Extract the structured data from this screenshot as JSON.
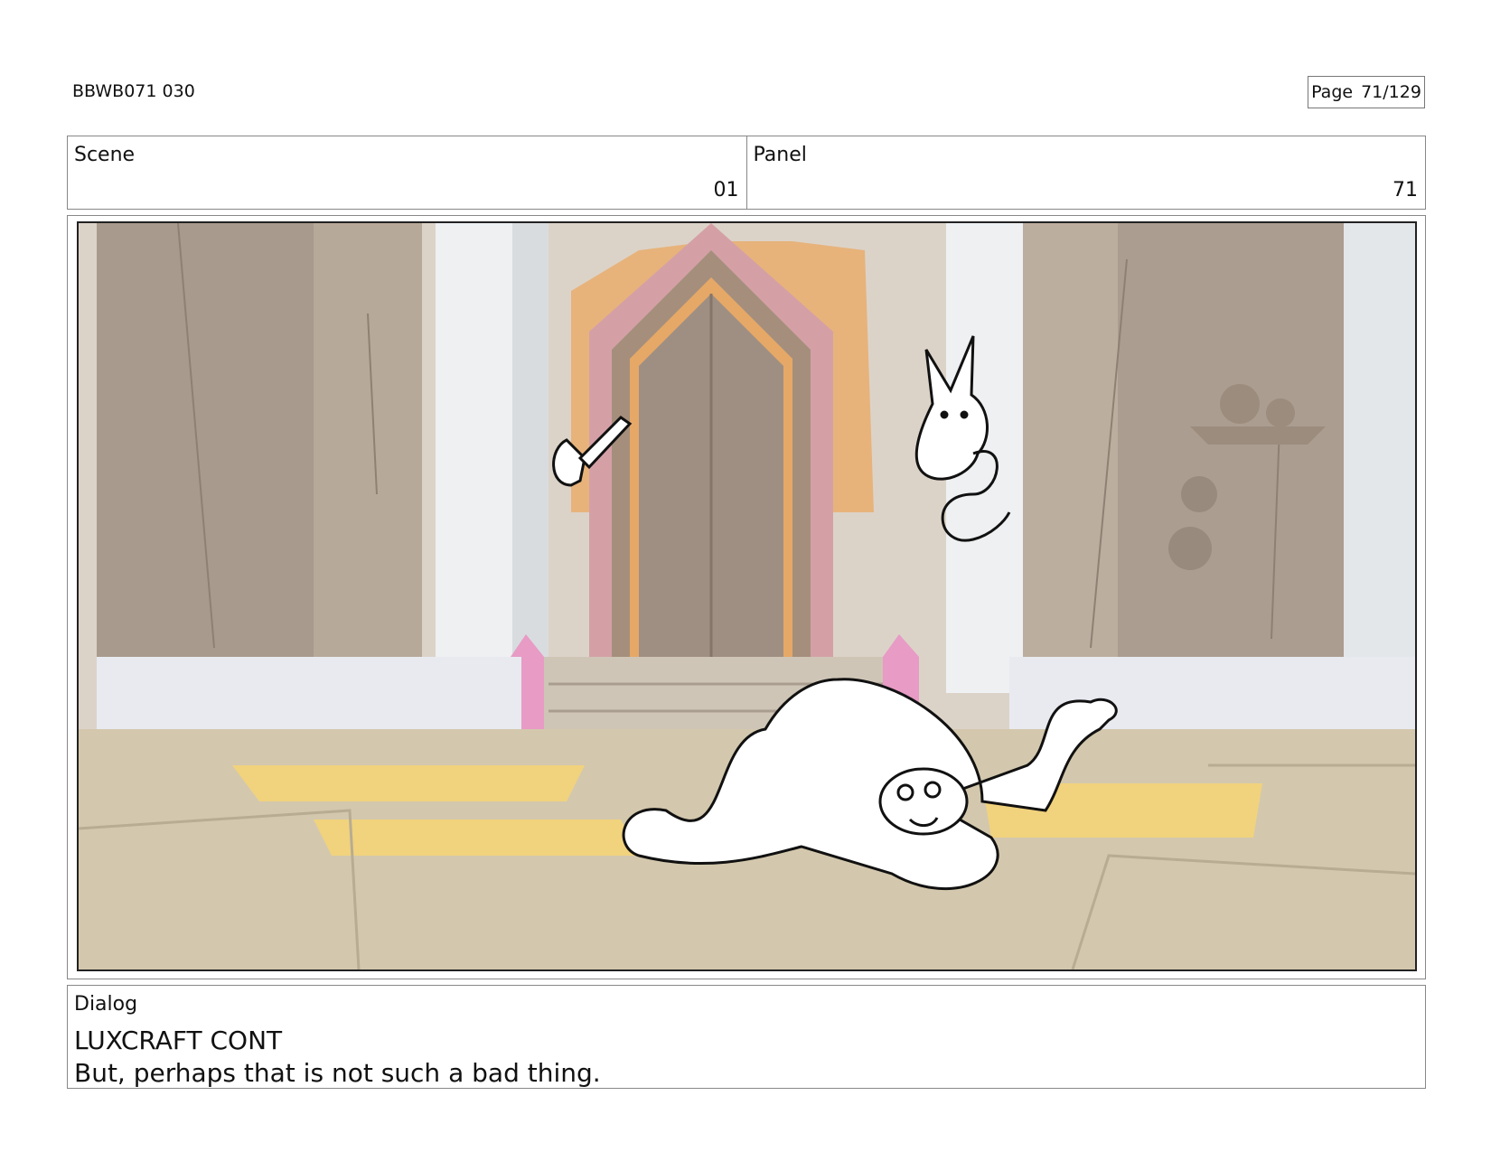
{
  "header": {
    "document_id": "BBWB071 030",
    "page_label": "Page",
    "page_number": "71/129"
  },
  "scene": {
    "label": "Scene",
    "value": "01"
  },
  "panel": {
    "label": "Panel",
    "value": "71"
  },
  "dialog": {
    "label": "Dialog",
    "speaker": "LUXCRAFT CONT",
    "line": "But, perhaps that is not such a bad thing."
  }
}
